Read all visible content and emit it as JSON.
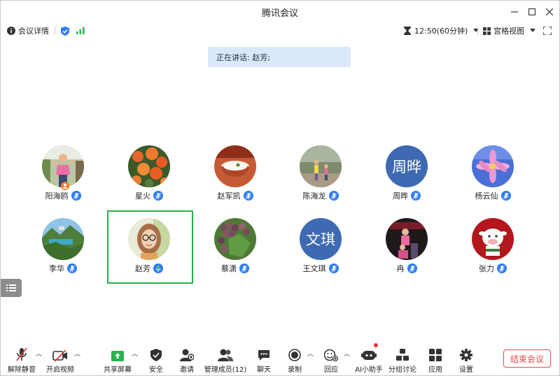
{
  "window": {
    "title": "腾讯会议"
  },
  "toolbar": {
    "meeting_info_label": "会议详情",
    "timer": "12:50(60分钟)",
    "view_label": "宫格视图"
  },
  "speaking": {
    "text": "正在讲话: 赵芳;"
  },
  "participants": [
    {
      "name": "阳海鸥",
      "avatar": "photo-woman-pink"
    },
    {
      "name": "星火",
      "avatar": "photo-orange-flowers"
    },
    {
      "name": "赵军凯",
      "avatar": "photo-yogurt-bowl"
    },
    {
      "name": "陈海龙",
      "avatar": "photo-children-outdoor"
    },
    {
      "name": "周晔",
      "avatar_text": "周晔"
    },
    {
      "name": "杨云仙",
      "avatar": "photo-pink-flower"
    },
    {
      "name": "李华",
      "avatar": "photo-mountain-lake"
    },
    {
      "name": "赵芳",
      "avatar": "photo-woman-glasses"
    },
    {
      "name": "蔡潇",
      "avatar": "photo-grapes"
    },
    {
      "name": "王文琪",
      "avatar_text": "文琪"
    },
    {
      "name": "冉",
      "avatar": "photo-girl-dark"
    },
    {
      "name": "张力",
      "avatar": "photo-cartoon-cow"
    }
  ],
  "bottom": {
    "unmute": "解除静音",
    "start_video": "开启视频",
    "share_screen": "共享屏幕",
    "security": "安全",
    "invite": "邀请",
    "manage_members": "管理成员(12)",
    "chat": "聊天",
    "record": "录制",
    "reaction": "回应",
    "ai_assistant": "AI小助手",
    "breakout": "分组讨论",
    "apps": "应用",
    "settings": "设置",
    "end_meeting": "结束会议"
  },
  "colors": {
    "accent": "#2f7cf6",
    "speaking_bg": "#dbe8fb",
    "selected_border": "#26b34a",
    "end_red": "#e84a4a",
    "text_avatar_bg": "#3e6ab3"
  }
}
